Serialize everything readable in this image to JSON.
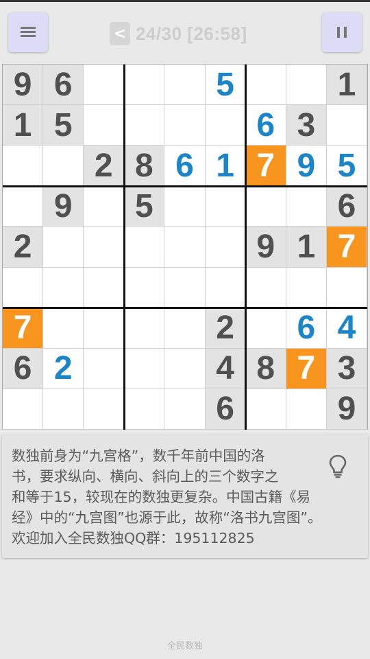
{
  "header": {
    "menu_icon": "menu-icon",
    "back_label": "<",
    "title": "24/30 [26:58]",
    "pause_icon": "pause-icon"
  },
  "board": {
    "colors": {
      "given_bg": "#e3e3e3",
      "given_text": "#505050",
      "user_text": "#1a85c8",
      "highlight_bg": "#f7951f"
    },
    "cells": [
      [
        {
          "v": "9",
          "t": "g"
        },
        {
          "v": "6",
          "t": "g"
        },
        {
          "v": "",
          "t": "e"
        },
        {
          "v": "",
          "t": "e"
        },
        {
          "v": "",
          "t": "e"
        },
        {
          "v": "5",
          "t": "u"
        },
        {
          "v": "",
          "t": "e"
        },
        {
          "v": "",
          "t": "e"
        },
        {
          "v": "1",
          "t": "g"
        }
      ],
      [
        {
          "v": "1",
          "t": "g"
        },
        {
          "v": "5",
          "t": "g"
        },
        {
          "v": "",
          "t": "e"
        },
        {
          "v": "",
          "t": "e"
        },
        {
          "v": "",
          "t": "e"
        },
        {
          "v": "",
          "t": "e"
        },
        {
          "v": "6",
          "t": "u"
        },
        {
          "v": "3",
          "t": "g"
        },
        {
          "v": "",
          "t": "e"
        }
      ],
      [
        {
          "v": "",
          "t": "e"
        },
        {
          "v": "",
          "t": "e"
        },
        {
          "v": "2",
          "t": "g"
        },
        {
          "v": "8",
          "t": "g"
        },
        {
          "v": "6",
          "t": "u"
        },
        {
          "v": "1",
          "t": "u"
        },
        {
          "v": "7",
          "t": "h"
        },
        {
          "v": "9",
          "t": "u"
        },
        {
          "v": "5",
          "t": "u"
        }
      ],
      [
        {
          "v": "",
          "t": "e"
        },
        {
          "v": "9",
          "t": "g"
        },
        {
          "v": "",
          "t": "e"
        },
        {
          "v": "5",
          "t": "g"
        },
        {
          "v": "",
          "t": "e"
        },
        {
          "v": "",
          "t": "e"
        },
        {
          "v": "",
          "t": "e"
        },
        {
          "v": "",
          "t": "e"
        },
        {
          "v": "6",
          "t": "g"
        }
      ],
      [
        {
          "v": "2",
          "t": "g"
        },
        {
          "v": "",
          "t": "e"
        },
        {
          "v": "",
          "t": "e"
        },
        {
          "v": "",
          "t": "e"
        },
        {
          "v": "",
          "t": "e"
        },
        {
          "v": "",
          "t": "e"
        },
        {
          "v": "9",
          "t": "g"
        },
        {
          "v": "1",
          "t": "g"
        },
        {
          "v": "7",
          "t": "h"
        }
      ],
      [
        {
          "v": "",
          "t": "e"
        },
        {
          "v": "",
          "t": "e"
        },
        {
          "v": "",
          "t": "e"
        },
        {
          "v": "",
          "t": "e"
        },
        {
          "v": "",
          "t": "e"
        },
        {
          "v": "",
          "t": "e"
        },
        {
          "v": "",
          "t": "e"
        },
        {
          "v": "",
          "t": "e"
        },
        {
          "v": "",
          "t": "e"
        }
      ],
      [
        {
          "v": "7",
          "t": "h"
        },
        {
          "v": "",
          "t": "e"
        },
        {
          "v": "",
          "t": "e"
        },
        {
          "v": "",
          "t": "e"
        },
        {
          "v": "",
          "t": "e"
        },
        {
          "v": "2",
          "t": "g"
        },
        {
          "v": "",
          "t": "e"
        },
        {
          "v": "6",
          "t": "u"
        },
        {
          "v": "4",
          "t": "u"
        }
      ],
      [
        {
          "v": "6",
          "t": "g"
        },
        {
          "v": "2",
          "t": "u"
        },
        {
          "v": "",
          "t": "e"
        },
        {
          "v": "",
          "t": "e"
        },
        {
          "v": "",
          "t": "e"
        },
        {
          "v": "4",
          "t": "g"
        },
        {
          "v": "8",
          "t": "g"
        },
        {
          "v": "7",
          "t": "h"
        },
        {
          "v": "3",
          "t": "g"
        }
      ],
      [
        {
          "v": "",
          "t": "e"
        },
        {
          "v": "",
          "t": "e"
        },
        {
          "v": "",
          "t": "e"
        },
        {
          "v": "",
          "t": "e"
        },
        {
          "v": "",
          "t": "e"
        },
        {
          "v": "6",
          "t": "g"
        },
        {
          "v": "",
          "t": "e"
        },
        {
          "v": "",
          "t": "e"
        },
        {
          "v": "9",
          "t": "g"
        }
      ]
    ]
  },
  "tip": {
    "lines": [
      "数独前身为“九宫格”，数千年前中国的洛",
      "书，要求纵向、横向、斜向上的三个数字之",
      "和等于15，较现在的数独更复杂。中国古籍《易",
      "经》中的“九宫图”也源于此，故称“洛书九宫图”。",
      "欢迎加入全民数独QQ群：195112825"
    ],
    "icon": "lightbulb-icon"
  },
  "footer": {
    "text": "全民数独"
  }
}
